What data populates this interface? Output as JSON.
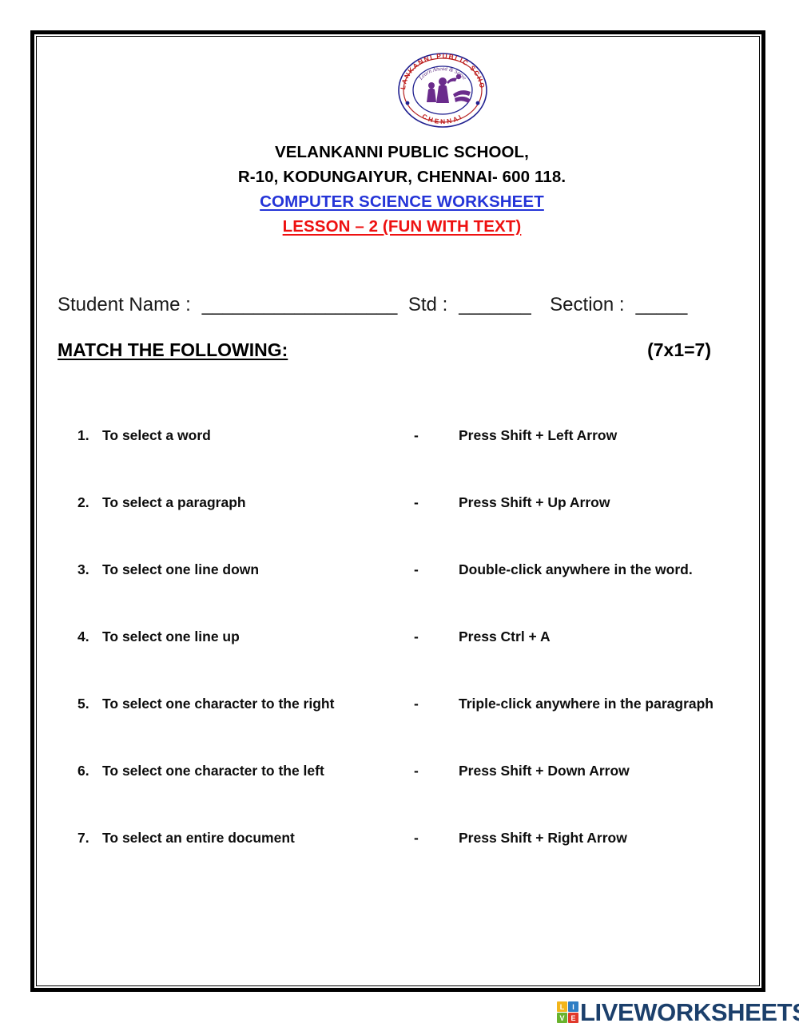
{
  "school": {
    "logo_alt": "velankanni-public-school-logo",
    "logo_arc_top": "VELANKANNI PUBLIC SCHOOL",
    "logo_arc_bottom": "CHENNAI",
    "logo_motto": "Learn Ahead & Serve",
    "name_line": "VELANKANNI PUBLIC SCHOOL,",
    "address_line": "R-10, KODUNGAIYUR, CHENNAI- 600 118.",
    "subject_line": "COMPUTER SCIENCE WORKSHEET",
    "lesson_line": "LESSON – 2 (FUN WITH TEXT)"
  },
  "colors": {
    "subject": "#2434d8",
    "lesson": "#ee1111",
    "body": "#0d0d0d",
    "logo_brand": "#1b3f6b"
  },
  "student_fields": {
    "name_label": "Student Name :",
    "name_blank": "___________________",
    "std_label": "Std :",
    "std_blank": "_______",
    "section_label": "Section :",
    "section_blank": "_____"
  },
  "exercise": {
    "title": "MATCH THE FOLLOWING:",
    "marks": "(7x1=7)",
    "separator": "-",
    "items": [
      {
        "num": "1.",
        "left": "To select a word",
        "right": "Press Shift + Left Arrow"
      },
      {
        "num": "2.",
        "left": "To select a paragraph",
        "right": "Press Shift + Up Arrow"
      },
      {
        "num": "3.",
        "left": "To select one line down",
        "right": "Double-click anywhere in the word."
      },
      {
        "num": "4.",
        "left": "To select one line up",
        "right": "Press Ctrl + A"
      },
      {
        "num": "5.",
        "left": "To select one character to the right",
        "right": "Triple-click anywhere in the paragraph"
      },
      {
        "num": "6.",
        "left": "To select one character to the left",
        "right": "Press Shift + Down Arrow"
      },
      {
        "num": "7.",
        "left": "To select an entire document",
        "right": "Press Shift + Right Arrow"
      }
    ]
  },
  "footer": {
    "brand": "LIVEWORKSHEETS",
    "blocks": [
      "L",
      "I",
      "V",
      "E"
    ]
  }
}
